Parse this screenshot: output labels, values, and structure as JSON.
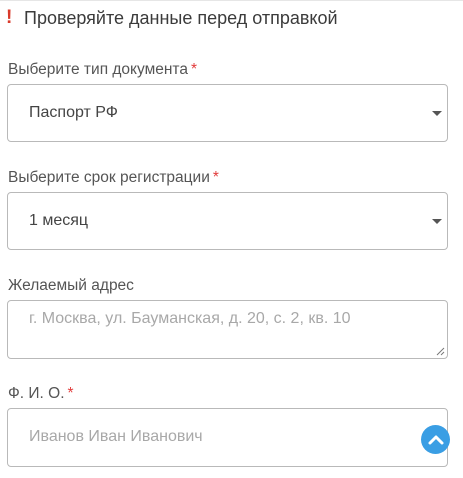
{
  "notice": {
    "icon": "exclamation-icon",
    "icon_glyph": "!",
    "text": "Проверяйте данные перед отправкой",
    "icon_color": "#d93a2b"
  },
  "fields": {
    "document_type": {
      "label": "Выберите тип документа",
      "required_mark": "*",
      "value": "Паспорт РФ"
    },
    "registration_period": {
      "label": "Выберите срок регистрации",
      "required_mark": "*",
      "value": "1 месяц"
    },
    "address": {
      "label": "Желаемый адрес",
      "placeholder": "г. Москва, ул. Бауманская, д. 20, с. 2, кв. 10"
    },
    "full_name": {
      "label": "Ф. И. О.",
      "required_mark": "*",
      "placeholder": "Иванов Иван Иванович"
    }
  },
  "scroll_top_button": {
    "icon": "chevron-up-icon",
    "color": "#3a9ee4"
  },
  "colors": {
    "required": "#e23b3b",
    "border": "#b9b9b9"
  }
}
